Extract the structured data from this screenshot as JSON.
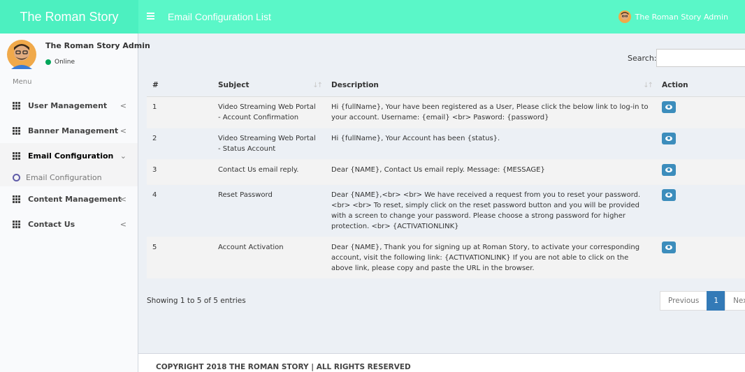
{
  "header": {
    "logo": "The Roman Story",
    "page_title": "Email Configuration List",
    "user_name": "The Roman Story Admin",
    "accent_color": "#5af7c8"
  },
  "sidebar": {
    "user": {
      "name": "The Roman Story Admin",
      "status": "Online"
    },
    "menu_header": "Menu",
    "items": [
      {
        "label": "User Management",
        "icon": "grid-icon",
        "chevron": "<"
      },
      {
        "label": "Banner Management",
        "icon": "grid-icon",
        "chevron": "<"
      },
      {
        "label": "Email Configuration",
        "icon": "grid-icon",
        "chevron": "⌄",
        "active": true
      },
      {
        "label": "Content Management",
        "icon": "grid-icon",
        "chevron": "<"
      },
      {
        "label": "Contact Us",
        "icon": "grid-icon",
        "chevron": "<"
      }
    ],
    "sub_items": [
      {
        "label": "Email Configuration",
        "icon": "circle-outline-icon"
      }
    ]
  },
  "search": {
    "label": "Search:",
    "value": ""
  },
  "table": {
    "columns": [
      "#",
      "Subject",
      "Description",
      "Action"
    ],
    "rows": [
      {
        "num": "1",
        "subject": "Video Streaming Web Portal - Account Confirmation",
        "description": "Hi {fullName}, Your have been registered as a User, Please click the below link to log-in to your account. Username: {email} <br> Pasword: {password}"
      },
      {
        "num": "2",
        "subject": "Video Streaming Web Portal - Status Account",
        "description": "Hi {fullName}, Your Account has been {status}."
      },
      {
        "num": "3",
        "subject": "Contact Us email reply.",
        "description": "Dear {NAME}, Contact Us email reply. Message: {MESSAGE}"
      },
      {
        "num": "4",
        "subject": "Reset Password",
        "description": "Dear {NAME},<br> <br> We have received a request from you to reset your password.<br> <br> To reset, simply click on the reset password button and you will be provided with a screen to change your password. Please choose a strong password for higher protection. <br> {ACTIVATIONLINK}"
      },
      {
        "num": "5",
        "subject": "Account Activation",
        "description": "Dear {NAME}, Thank you for signing up at Roman Story, to activate your corresponding account, visit the following link: {ACTIVATIONLINK} If you are not able to click on the above link, please copy and paste the URL in the browser."
      }
    ]
  },
  "info": "Showing 1 to 5 of 5 entries",
  "pagination": {
    "previous": "Previous",
    "current": "1",
    "next": "Next"
  },
  "footer": "COPYRIGHT 2018 THE ROMAN STORY | ALL RIGHTS RESERVED"
}
